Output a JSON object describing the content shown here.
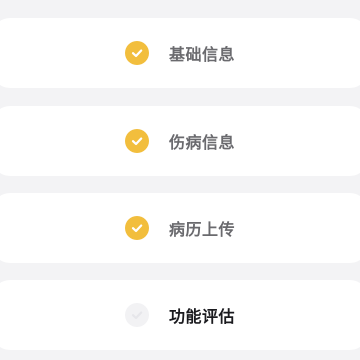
{
  "steps": [
    {
      "label": "基础信息",
      "status": "done"
    },
    {
      "label": "伤病信息",
      "status": "done"
    },
    {
      "label": "病历上传",
      "status": "done"
    },
    {
      "label": "功能评估",
      "status": "current"
    }
  ],
  "colors": {
    "accent": "#f2be3d",
    "background": "#f3f3f5",
    "card": "#ffffff",
    "text_done": "#6a6a6e",
    "text_current": "#1b1b1f",
    "pending_badge": "#f2f2f4"
  },
  "icons": {
    "done": "check-circle-icon",
    "pending": "empty-circle-icon"
  }
}
